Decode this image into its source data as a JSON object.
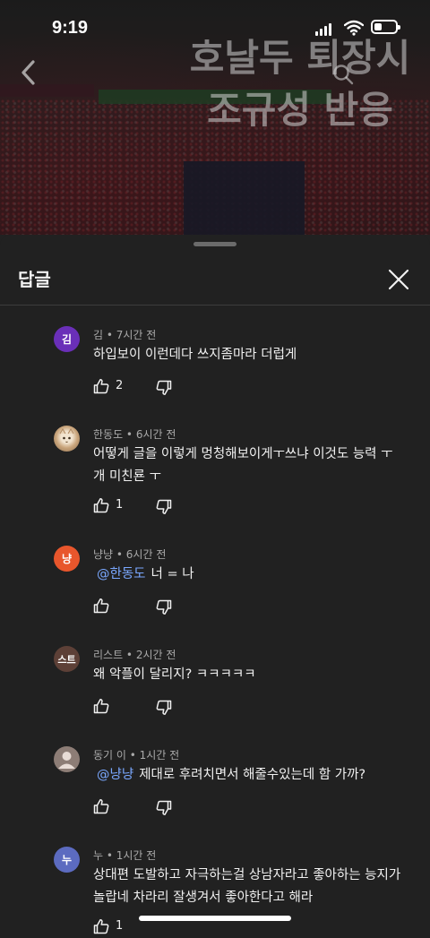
{
  "status_bar": {
    "time": "9:19"
  },
  "video": {
    "title_line1": "호날두 퇴장시",
    "title_line2": "조규성 반응"
  },
  "sheet": {
    "title": "답글"
  },
  "comments": [
    {
      "avatar_text": "김",
      "avatar_color": "#6a2fb8",
      "meta": "김 • 7시간 전",
      "mention": "",
      "text": "하입보이 이런데다 쓰지좀마라 더럽게",
      "likes": "2"
    },
    {
      "avatar_text": "",
      "avatar_color": "#b99675",
      "meta": "한동도 • 6시간 전",
      "mention": "",
      "text": "어떻게 글을 이렇게 멍청해보이게ㅜ쓰냐 이것도 능력 ㅜ 개 미친룐 ㅜ",
      "likes": "1"
    },
    {
      "avatar_text": "냥",
      "avatar_color": "#e8562c",
      "meta": "냥냥 • 6시간 전",
      "mention": "@한동도",
      "text": "너 = 나",
      "likes": ""
    },
    {
      "avatar_text": "스트",
      "avatar_color": "#5d4037",
      "meta": "리스트 • 2시간 전",
      "mention": "",
      "text": "왜 악플이 달리지? ㅋㅋㅋㅋㅋ",
      "likes": ""
    },
    {
      "avatar_text": "",
      "avatar_color": "#8d7d76",
      "meta": "동기 이 • 1시간 전",
      "mention": "@냥냥",
      "text": "제대로 후려치면서 해줄수있는데 함 가까?",
      "likes": ""
    },
    {
      "avatar_text": "누",
      "avatar_color": "#5c6bc0",
      "meta": "누 • 1시간 전",
      "mention": "",
      "text": "상대편 도발하고 자극하는걸 상남자라고 좋아하는 능지가 놀랍네 차라리 잘생겨서 좋아한다고 해라",
      "likes": "1"
    }
  ],
  "icons": {
    "back": "chevron-left-icon",
    "search": "search-icon",
    "close": "close-icon",
    "like": "thumbs-up-icon",
    "dislike": "thumbs-down-icon"
  }
}
